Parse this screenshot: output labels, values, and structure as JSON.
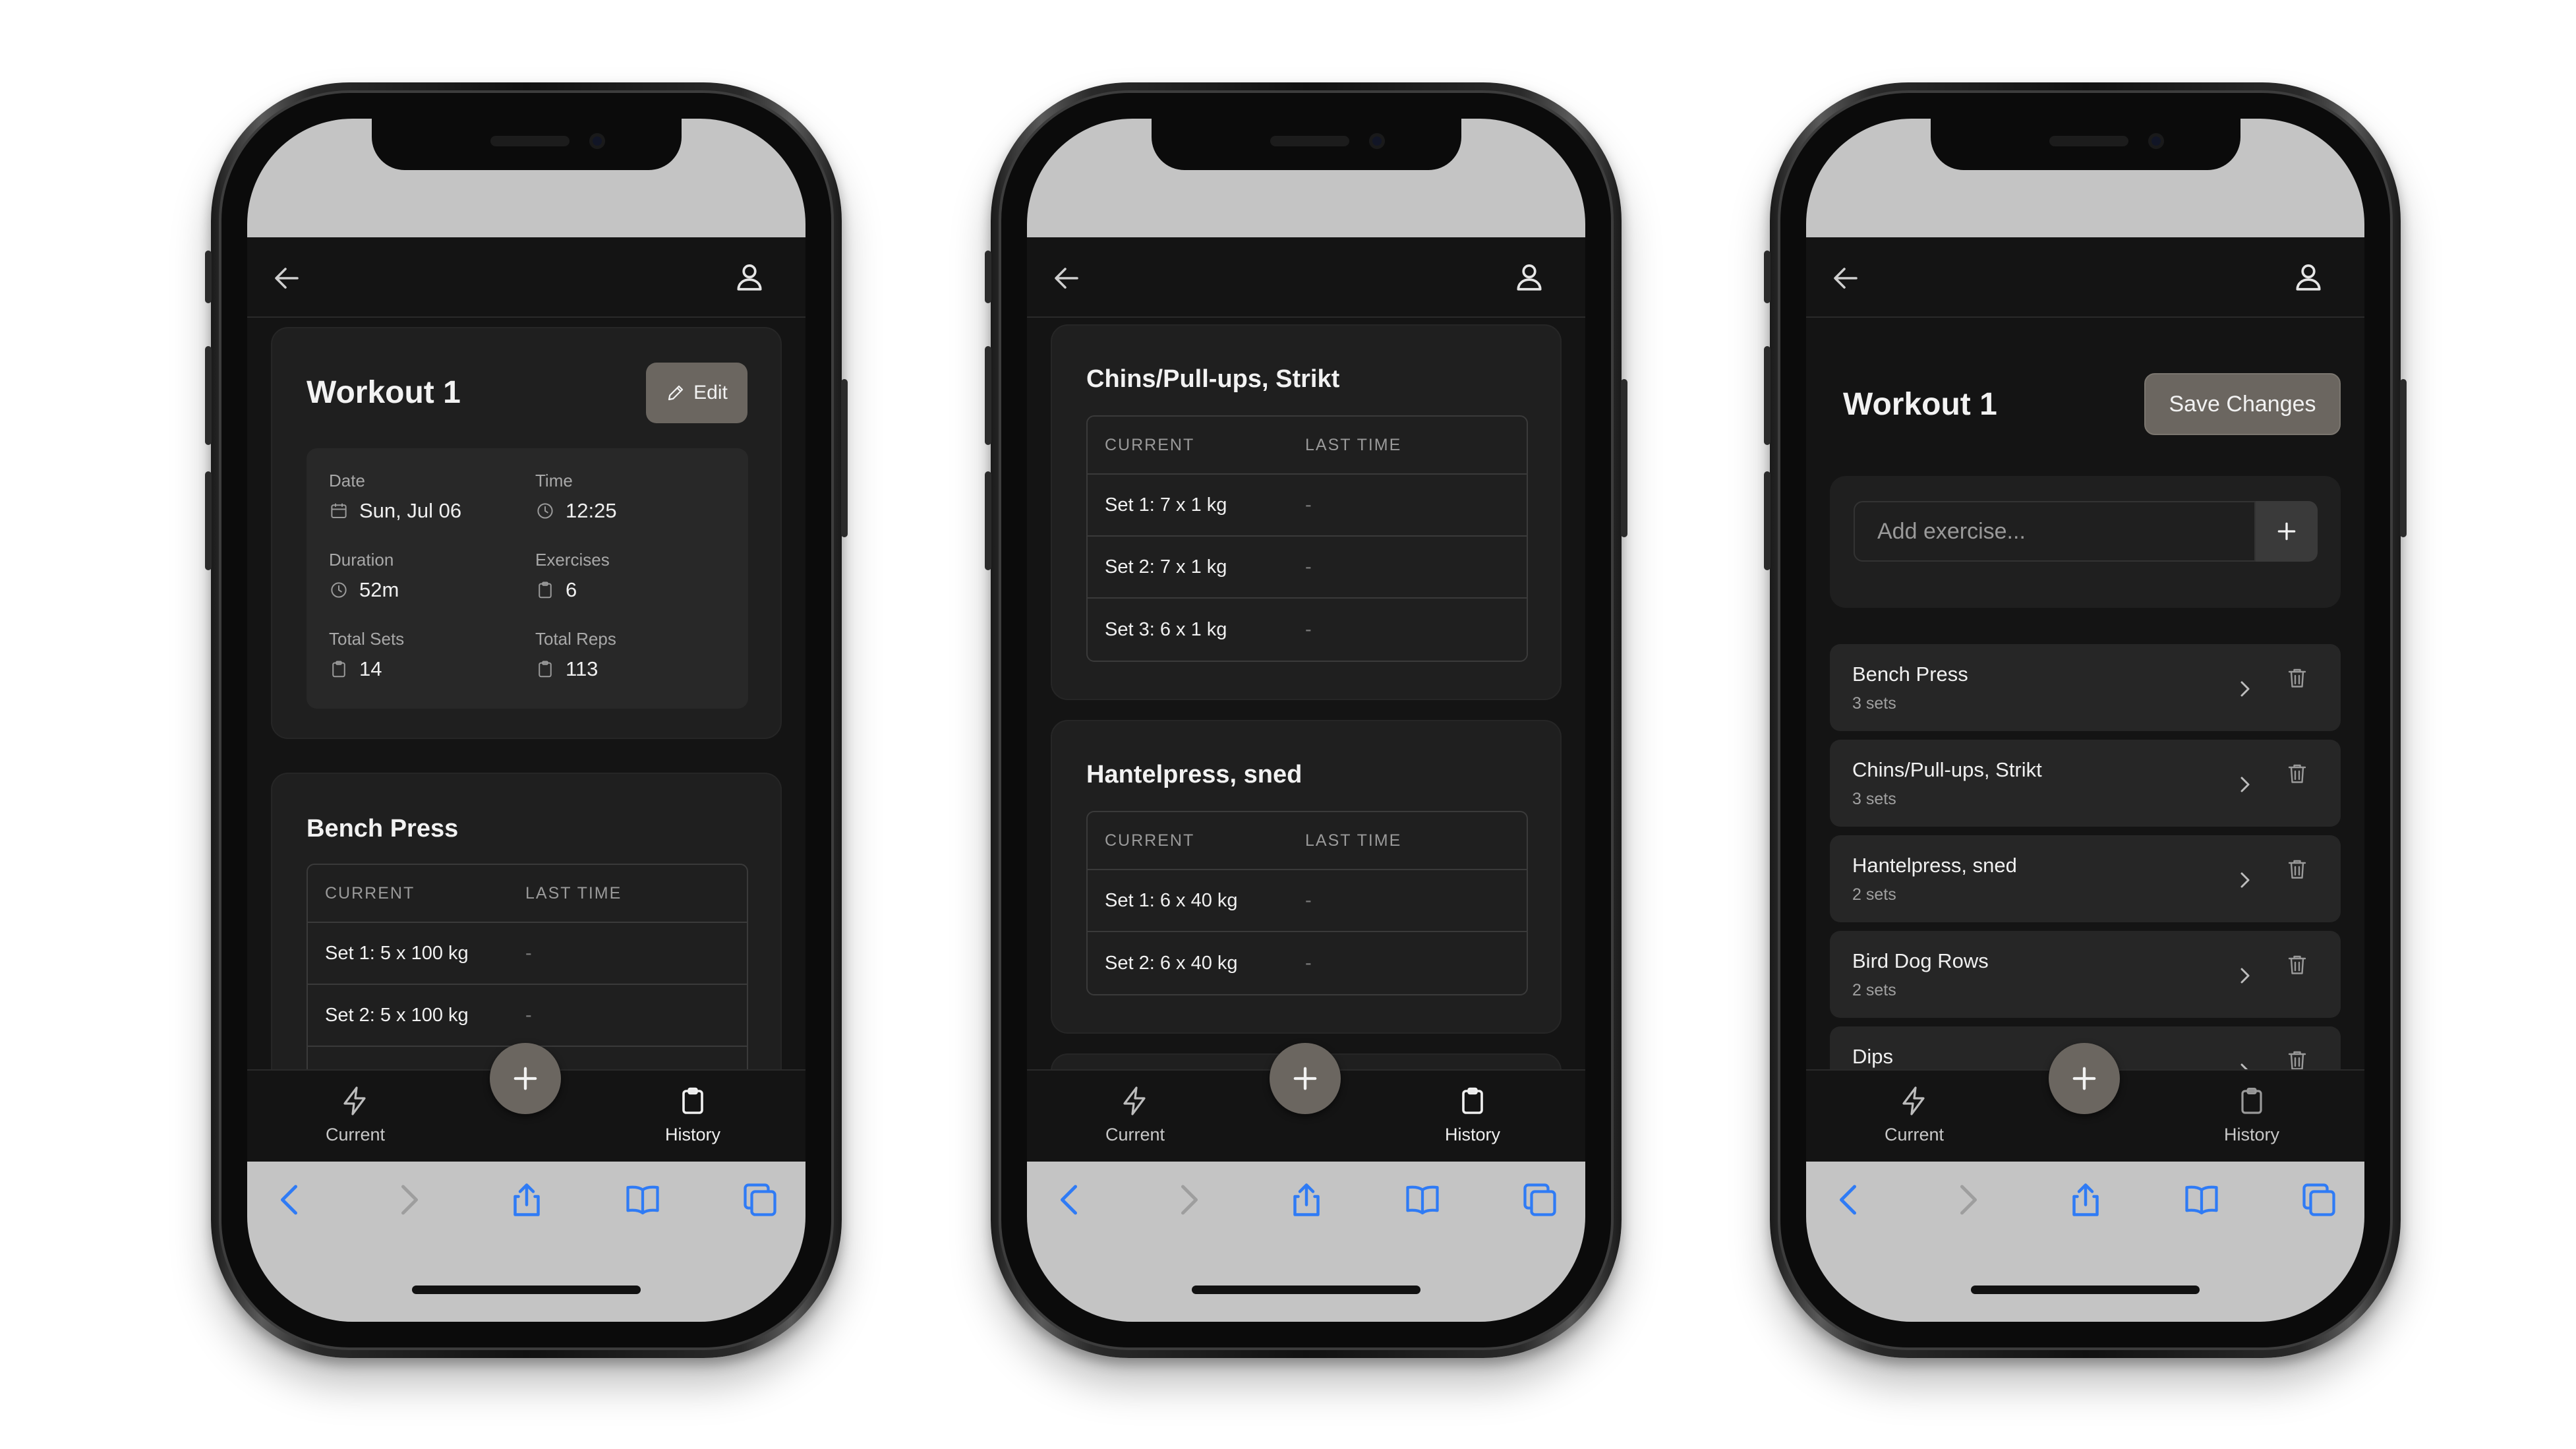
{
  "colors": {
    "app_bg": "#141414",
    "card_bg": "#1f1f1f",
    "accent_button": "#6b6660",
    "browser_chrome": "#c4c4c4",
    "browser_icon": "#2f7bf5"
  },
  "nav": {
    "current_label": "Current",
    "history_label": "History",
    "current_icon": "lightning-icon",
    "history_icon": "clipboard-icon",
    "fab_icon": "plus-icon"
  },
  "screen1": {
    "workout_title": "Workout 1",
    "edit_label": "Edit",
    "stats": {
      "date_label": "Date",
      "date_value": "Sun, Jul 06",
      "time_label": "Time",
      "time_value": "12:25",
      "duration_label": "Duration",
      "duration_value": "52m",
      "exercises_label": "Exercises",
      "exercises_value": "6",
      "total_sets_label": "Total Sets",
      "total_sets_value": "14",
      "total_reps_label": "Total Reps",
      "total_reps_value": "113"
    },
    "exercise": {
      "name": "Bench Press",
      "col_current": "CURRENT",
      "col_last": "LAST TIME",
      "rows": [
        {
          "current": "Set 1: 5 x 100 kg",
          "last": "-"
        },
        {
          "current": "Set 2: 5 x 100 kg",
          "last": "-"
        }
      ]
    }
  },
  "screen2": {
    "exercises": [
      {
        "name": "Chins/Pull-ups, Strikt",
        "col_current": "CURRENT",
        "col_last": "LAST TIME",
        "rows": [
          {
            "current": "Set 1: 7 x 1 kg",
            "last": "-"
          },
          {
            "current": "Set 2: 7 x 1 kg",
            "last": "-"
          },
          {
            "current": "Set 3: 6 x 1 kg",
            "last": "-"
          }
        ]
      },
      {
        "name": "Hantelpress, sned",
        "col_current": "CURRENT",
        "col_last": "LAST TIME",
        "rows": [
          {
            "current": "Set 1: 6 x 40 kg",
            "last": "-"
          },
          {
            "current": "Set 2: 6 x 40 kg",
            "last": "-"
          }
        ]
      }
    ]
  },
  "screen3": {
    "workout_title": "Workout 1",
    "save_label": "Save Changes",
    "add_placeholder": "Add exercise...",
    "exercises": [
      {
        "name": "Bench Press",
        "sets": "3 sets"
      },
      {
        "name": "Chins/Pull-ups, Strikt",
        "sets": "3 sets"
      },
      {
        "name": "Hantelpress, sned",
        "sets": "2 sets"
      },
      {
        "name": "Bird Dog Rows",
        "sets": "2 sets"
      },
      {
        "name": "Dips",
        "sets": ""
      }
    ]
  }
}
